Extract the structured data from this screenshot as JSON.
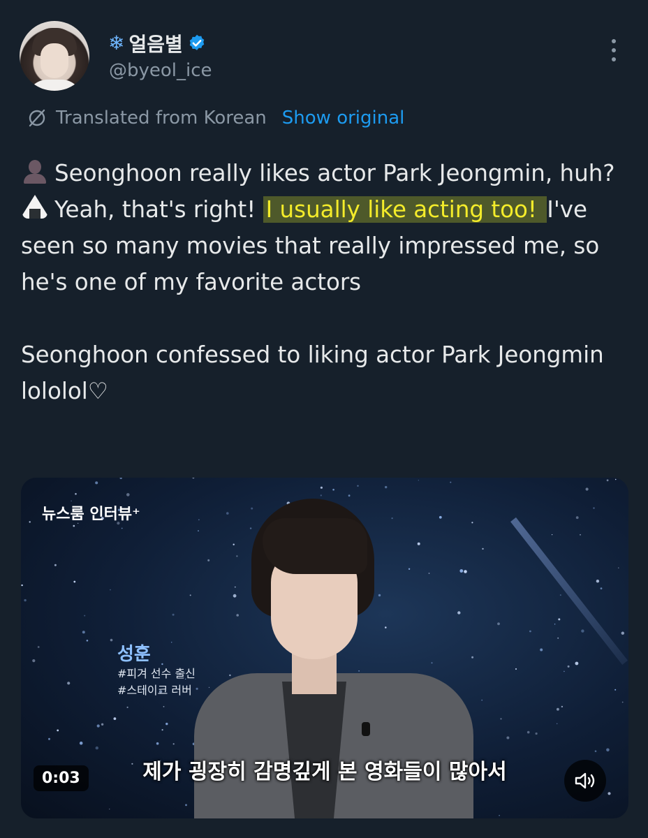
{
  "author": {
    "display_name": "얼음별",
    "name_emoji": "❄",
    "handle": "@byeol_ice",
    "verified": true
  },
  "translation": {
    "note": "Translated from Korean",
    "show_original": "Show original"
  },
  "post": {
    "line1": "Seonghoon really likes actor Park Jeongmin, huh?",
    "line2_before": "Yeah, that's right! ",
    "line2_highlight": "I usually like acting too! ",
    "line2_after": "I've seen so many movies that really impressed me, so he's one of my favorite actors",
    "line3": "Seonghoon confessed to liking actor Park Jeongmin lololol♡",
    "highlight_color": "#f4ec2a"
  },
  "media": {
    "logo": "뉴스룸 인터뷰⁺",
    "caption_name": "성훈",
    "caption_tag1": "#피겨 선수 출신",
    "caption_tag2": "#스테이크 러버",
    "subtitle": "제가 굉장히 감명깊게 본 영화들이 많아서",
    "timestamp": "0:03",
    "mute_icon": "speaker-icon"
  },
  "colors": {
    "background": "#16202b",
    "link": "#1d9bf0",
    "muted_text": "#8b98a5",
    "text": "#e7e9ea"
  }
}
